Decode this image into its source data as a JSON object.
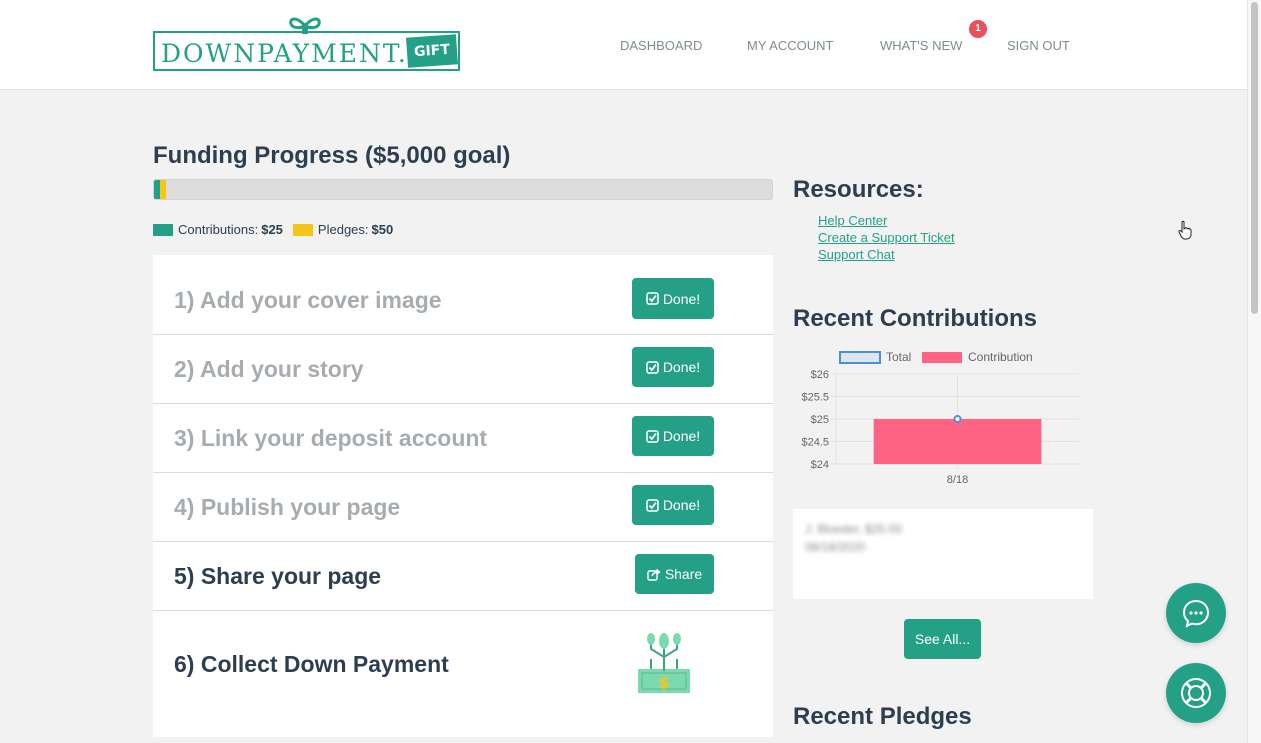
{
  "header": {
    "logo_text": "DOWNPAYMENT.",
    "logo_gift": "GIFT",
    "nav": [
      {
        "label": "DASHBOARD"
      },
      {
        "label": "MY ACCOUNT"
      },
      {
        "label": "WHAT'S NEW",
        "badge": "1"
      },
      {
        "label": "SIGN OUT"
      }
    ]
  },
  "funding": {
    "title": "Funding Progress ($5,000 goal)",
    "goal": 5000,
    "contributions": 25,
    "pledges": 50,
    "contributions_label": "Contributions:",
    "contributions_value": "$25",
    "pledges_label": "Pledges:",
    "pledges_value": "$50"
  },
  "steps": [
    {
      "label": "1) Add your cover image",
      "button": "Done!",
      "done": true
    },
    {
      "label": "2) Add your story",
      "button": "Done!",
      "done": true
    },
    {
      "label": "3) Link your deposit account",
      "button": "Done!",
      "done": true
    },
    {
      "label": "4) Publish your page",
      "button": "Done!",
      "done": true
    },
    {
      "label": "5) Share your page",
      "button": "Share",
      "done": false
    },
    {
      "label": "6) Collect Down Payment",
      "button": "",
      "done": false
    }
  ],
  "resources": {
    "title": "Resources:",
    "links": [
      "Help Center",
      "Create a Support Ticket",
      "Support Chat"
    ]
  },
  "recent_contributions": {
    "title": "Recent Contributions",
    "blurred_line_1": "J. Bloeder, $25.00",
    "blurred_line_2": "08/18/2020",
    "see_all": "See All..."
  },
  "chart_data": {
    "type": "bar",
    "categories": [
      "8/18"
    ],
    "series": [
      {
        "name": "Total",
        "type": "line",
        "values": [
          25
        ]
      },
      {
        "name": "Contribution",
        "type": "bar",
        "values": [
          25
        ]
      }
    ],
    "ylim": [
      24,
      26
    ],
    "yticks": [
      "$26",
      "$25.5",
      "$25",
      "$24.5",
      "$24"
    ],
    "legend_position": "top",
    "grid": true,
    "colors": {
      "total": "#4a90d9",
      "contribution": "#ff6384"
    }
  },
  "recent_pledges": {
    "title": "Recent Pledges"
  },
  "colors": {
    "brand": "#23a086",
    "pledge": "#f5c518",
    "badge": "#e8505b"
  }
}
